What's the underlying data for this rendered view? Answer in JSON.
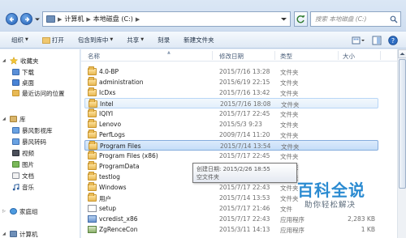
{
  "address": {
    "crumbs": [
      "计算机",
      "本地磁盘 (C:)"
    ],
    "search_placeholder": "搜索 本地磁盘 (C:)"
  },
  "toolbar": {
    "organize": "组织",
    "open": "打开",
    "include_library": "包含到库中",
    "share": "共享",
    "burn": "刻录",
    "new_folder": "新建文件夹"
  },
  "nav": {
    "favorites": "收藏夹",
    "downloads": "下载",
    "desktop": "桌面",
    "recent": "最近访问的位置",
    "libraries": "库",
    "lib_video_storm": "暴风影视库",
    "lib_storm_convert": "暴风转码",
    "videos": "视频",
    "pictures": "图片",
    "documents": "文档",
    "music": "音乐",
    "homegroup": "家庭组",
    "computer": "计算机"
  },
  "columns": {
    "name": "名称",
    "date": "修改日期",
    "type": "类型",
    "size": "大小"
  },
  "files": [
    {
      "name": "4.0-BP",
      "date": "2015/7/16 13:28",
      "type": "文件夹",
      "size": "",
      "kind": "folder"
    },
    {
      "name": "administration",
      "date": "2015/6/19 22:15",
      "type": "文件夹",
      "size": "",
      "kind": "folder"
    },
    {
      "name": "IcDxs",
      "date": "2015/7/16 13:42",
      "type": "文件夹",
      "size": "",
      "kind": "folder"
    },
    {
      "name": "Intel",
      "date": "2015/7/16 18:08",
      "type": "文件夹",
      "size": "",
      "kind": "folder"
    },
    {
      "name": "IQIYI",
      "date": "2015/7/17 22:45",
      "type": "文件夹",
      "size": "",
      "kind": "folder"
    },
    {
      "name": "Lenovo",
      "date": "2015/5/3 9:23",
      "type": "文件夹",
      "size": "",
      "kind": "folder"
    },
    {
      "name": "PerfLogs",
      "date": "2009/7/14 11:20",
      "type": "文件夹",
      "size": "",
      "kind": "folder"
    },
    {
      "name": "Program Files",
      "date": "2015/7/14 13:54",
      "type": "文件夹",
      "size": "",
      "kind": "folder"
    },
    {
      "name": "Program Files (x86)",
      "date": "2015/7/17 22:45",
      "type": "文件夹",
      "size": "",
      "kind": "folder"
    },
    {
      "name": "ProgramData",
      "date": "2015/7/17 22:45",
      "type": "文件夹",
      "size": "",
      "kind": "folder"
    },
    {
      "name": "testlog",
      "date": "2015/7/17 22:43",
      "type": "文件夹",
      "size": "",
      "kind": "folder"
    },
    {
      "name": "Windows",
      "date": "2015/7/17 22:43",
      "type": "文件夹",
      "size": "",
      "kind": "folder"
    },
    {
      "name": "用户",
      "date": "2015/7/14 13:53",
      "type": "文件夹",
      "size": "",
      "kind": "folder"
    },
    {
      "name": "setup",
      "date": "2015/7/17 21:46",
      "type": "文件",
      "size": "",
      "kind": "file"
    },
    {
      "name": "vcredist_x86",
      "date": "2015/7/17 22:43",
      "type": "应用程序",
      "size": "2,283 KB",
      "kind": "exe"
    },
    {
      "name": "ZgRenceCon",
      "date": "2015/3/11 14:13",
      "type": "应用程序",
      "size": "1 KB",
      "kind": "app"
    }
  ],
  "tooltip": {
    "line1": "创建日期: 2015/2/26 18:55",
    "line2": "空文件夹"
  },
  "watermark": {
    "title": "百科全说",
    "subtitle": "助你轻松解决"
  }
}
